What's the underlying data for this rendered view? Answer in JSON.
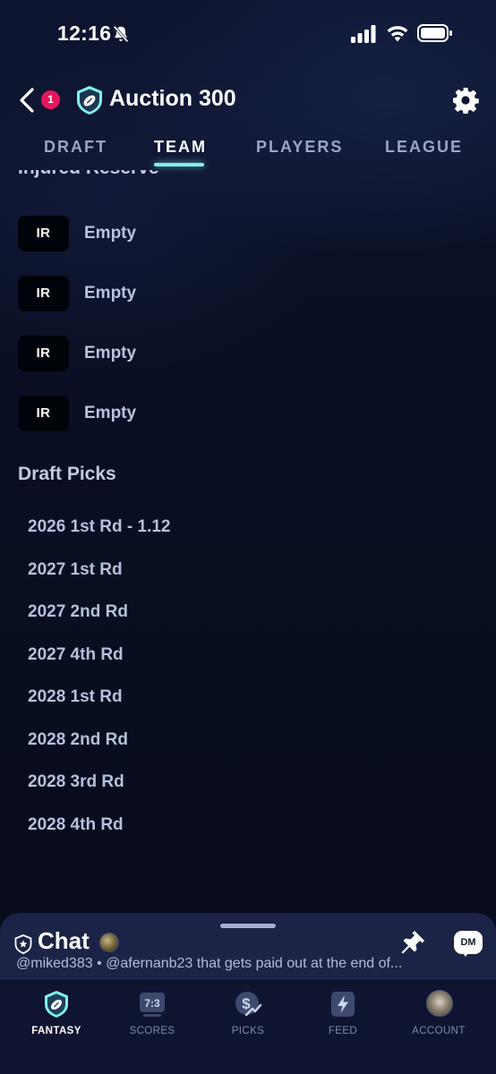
{
  "status_bar": {
    "time": "12:16",
    "icons": [
      "bell-slash-icon",
      "signal-icon",
      "wifi-icon",
      "battery-icon"
    ]
  },
  "header": {
    "notification_count": "1",
    "title": "Auction 300",
    "icons": [
      "back-icon",
      "league-logo-icon",
      "gear-icon"
    ]
  },
  "tabs": [
    {
      "label": "DRAFT",
      "active": false
    },
    {
      "label": "TEAM",
      "active": true
    },
    {
      "label": "PLAYERS",
      "active": false
    },
    {
      "label": "LEAGUE",
      "active": false
    }
  ],
  "injured_reserve": {
    "heading": "Injured Reserve",
    "slots": [
      {
        "chip": "IR",
        "label": "Empty"
      },
      {
        "chip": "IR",
        "label": "Empty"
      },
      {
        "chip": "IR",
        "label": "Empty"
      },
      {
        "chip": "IR",
        "label": "Empty"
      }
    ]
  },
  "draft_picks": {
    "heading": "Draft Picks",
    "items": [
      "2026 1st Rd - 1.12",
      "2027 1st Rd",
      "2027 2nd Rd",
      "2027 4th Rd",
      "2028 1st Rd",
      "2028 2nd Rd",
      "2028 3rd Rd",
      "2028 4th Rd"
    ]
  },
  "chat": {
    "title": "Chat",
    "dm_label": "DM",
    "preview": "@miked383 • @afernanb23 that gets paid out at the end of...",
    "icons": [
      "shield-icon",
      "pin-icon",
      "dm-bubble-icon"
    ]
  },
  "bottom_nav": [
    {
      "label": "FANTASY",
      "icon": "football-shield-icon",
      "active": true
    },
    {
      "label": "SCORES",
      "icon": "scoreboard-icon",
      "active": false
    },
    {
      "label": "PICKS",
      "icon": "money-trend-icon",
      "active": false
    },
    {
      "label": "FEED",
      "icon": "lightning-icon",
      "active": false
    },
    {
      "label": "ACCOUNT",
      "icon": "avatar",
      "active": false
    }
  ],
  "colors": {
    "background": "#0a0f22",
    "accent": "#7ff2e6",
    "badge": "#e8175d",
    "chat_panel": "#1b2446"
  }
}
